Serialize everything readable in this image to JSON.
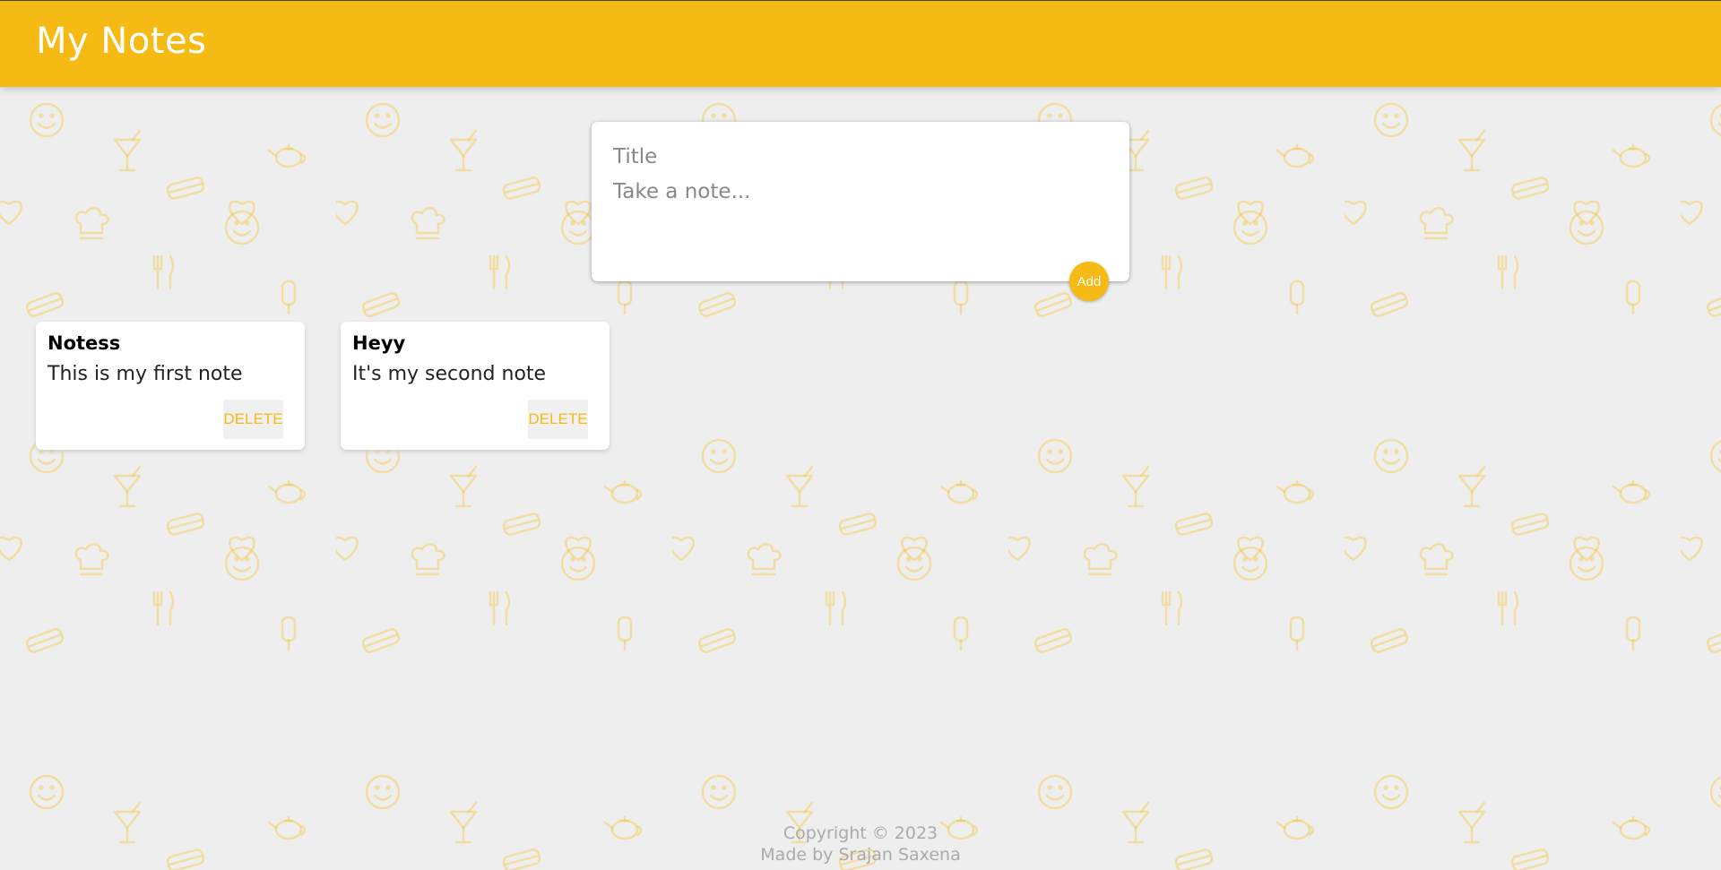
{
  "app": {
    "title": "My Notes"
  },
  "create_note": {
    "title_placeholder": "Title",
    "content_placeholder": "Take a note...",
    "add_label": "Add"
  },
  "notes": [
    {
      "title": "Notess",
      "content": "This is my first note",
      "delete_label": "DELETE"
    },
    {
      "title": "Heyy",
      "content": "It's my second note",
      "delete_label": "DELETE"
    }
  ],
  "footer": {
    "copyright": "Copyright © 2023",
    "credit": "Made by Srajan Saxena"
  },
  "colors": {
    "accent": "#f5ba13",
    "background": "#eeeeee",
    "pattern": "#f5ba13"
  },
  "background_icons": [
    "smiley-icon",
    "cocktail-icon",
    "teapot-icon",
    "sandwich-icon",
    "heart-icon",
    "chef-hat-icon",
    "cutlery-icon",
    "popsicle-icon"
  ]
}
